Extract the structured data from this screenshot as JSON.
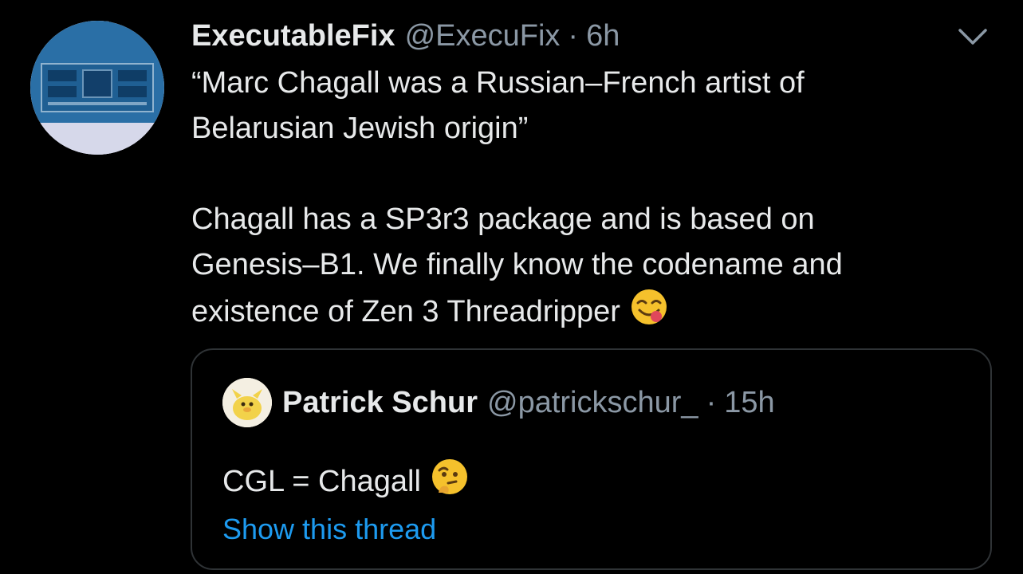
{
  "tweet": {
    "author": {
      "display_name": "ExecutableFix",
      "handle": "@ExecuFix",
      "separator": "·",
      "time": "6h"
    },
    "menu_icon": "chevron-down-icon",
    "text": {
      "line1": "“Marc Chagall was a Russian–French artist of",
      "line2": "Belarusian Jewish origin”",
      "line3": "Chagall has a SP3r3 package and is based on",
      "line4": "Genesis–B1. We finally know the codename and",
      "line5": "existence of Zen 3 Threadripper"
    },
    "emoji": "face-savoring-food-emoji"
  },
  "quoted_tweet": {
    "author": {
      "display_name": "Patrick Schur",
      "handle": "@patrickschur_",
      "separator": "·",
      "time": "15h"
    },
    "text": "CGL = Chagall",
    "emoji": "thinking-face-emoji",
    "show_thread": "Show this thread"
  },
  "colors": {
    "background": "#000000",
    "text_primary": "#e7e9ea",
    "text_secondary": "#8b98a5",
    "link": "#1d9bf0",
    "border": "#2f3336"
  }
}
